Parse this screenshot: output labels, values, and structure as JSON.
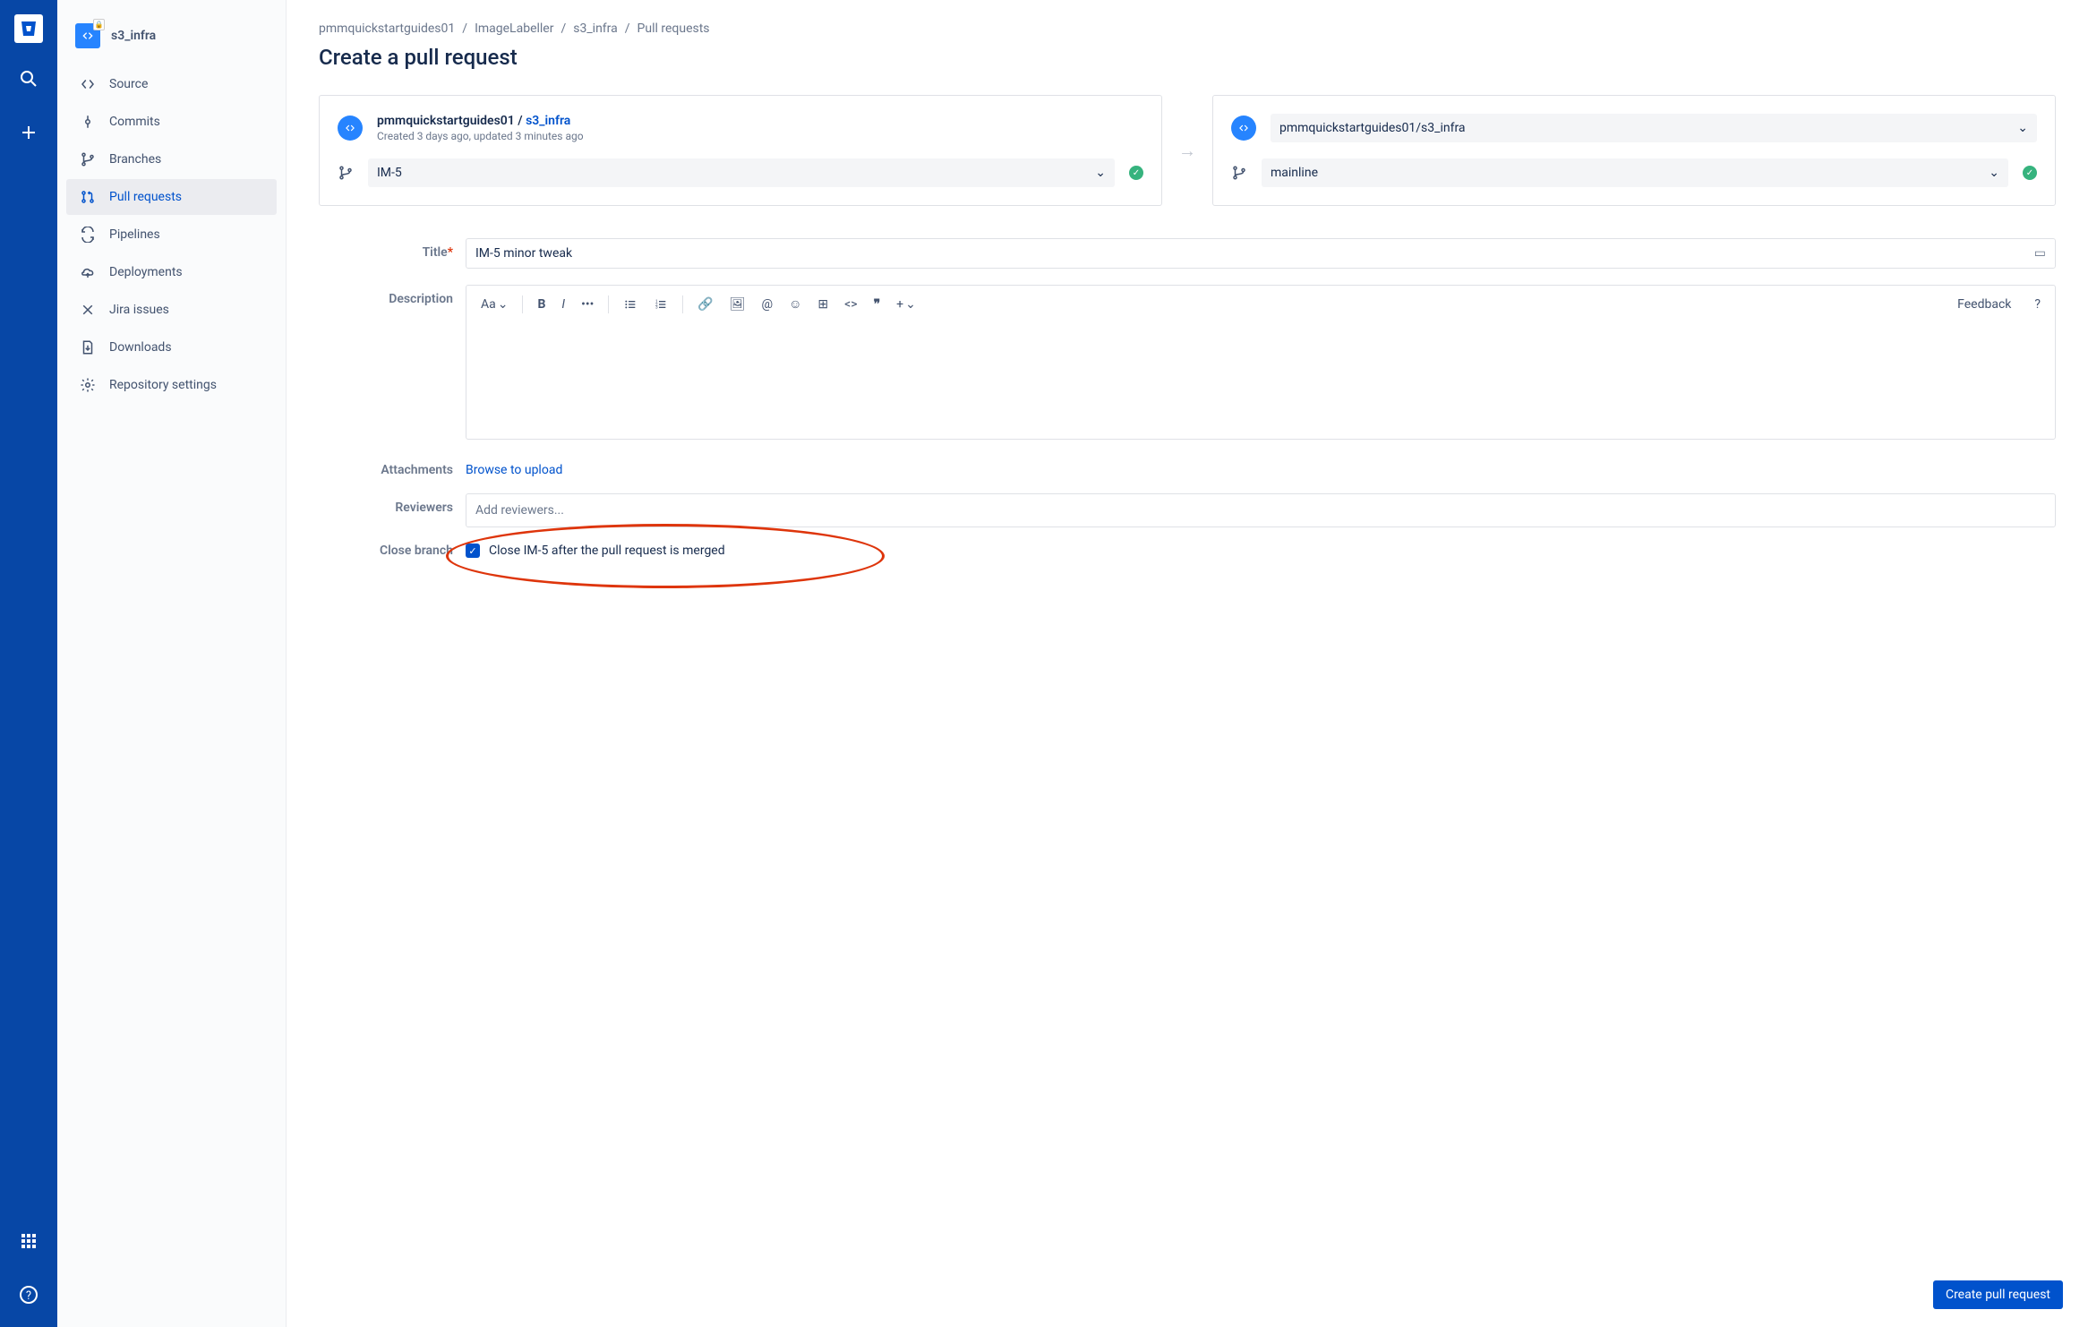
{
  "repo_title": "s3_infra",
  "breadcrumb": [
    "pmmquickstartguides01",
    "ImageLabeller",
    "s3_infra",
    "Pull requests"
  ],
  "page_title": "Create a pull request",
  "nav": [
    "Source",
    "Commits",
    "Branches",
    "Pull requests",
    "Pipelines",
    "Deployments",
    "Jira issues",
    "Downloads",
    "Repository settings"
  ],
  "source": {
    "owner": "pmmquickstartguides01",
    "repo": "s3_infra",
    "meta": "Created 3 days ago, updated 3 minutes ago",
    "branch": "IM-5"
  },
  "dest": {
    "repo": "pmmquickstartguides01/s3_infra",
    "branch": "mainline"
  },
  "form": {
    "title_label": "Title",
    "title_value": "IM-5 minor tweak",
    "desc_label": "Description",
    "attach_label": "Attachments",
    "attach_action": "Browse to upload",
    "reviewers_label": "Reviewers",
    "reviewers_placeholder": "Add reviewers...",
    "close_label": "Close branch",
    "close_text": "Close IM-5 after the pull request is merged"
  },
  "toolbar": {
    "text_style": "Aa",
    "feedback": "Feedback"
  },
  "submit": "Create pull request"
}
